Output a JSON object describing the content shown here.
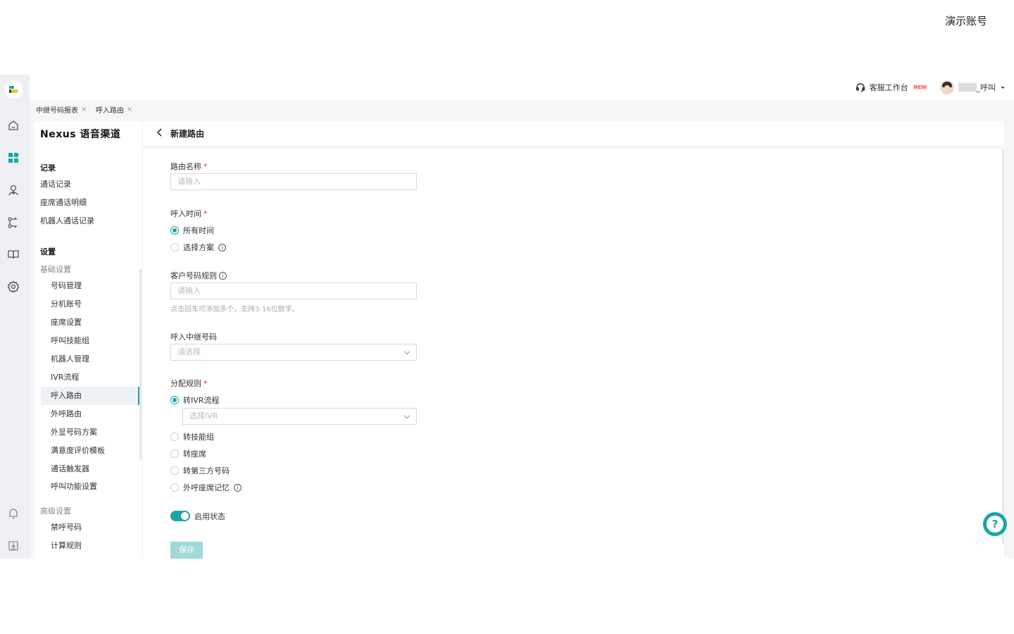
{
  "demo_label": "演示账号",
  "colors": {
    "accent": "#1aa6a6",
    "required": "#f5222d",
    "new_badge": "#ff4d4f"
  },
  "topbar": {
    "workbench_label": "客服工作台",
    "new_badge": "NEW",
    "user_suffix": "_呼叫"
  },
  "tabs": [
    {
      "label": "中继号码报表",
      "close": "×"
    },
    {
      "label": "呼入路由",
      "close": "×"
    }
  ],
  "rail_icons": [
    "home-icon",
    "dashboard-icon",
    "agent-icon",
    "route-icon",
    "book-icon",
    "settings-icon",
    "bell-icon",
    "download-icon"
  ],
  "sidebar": {
    "title": "Nexus 语音渠道",
    "records_group": "记录",
    "records": [
      "通话记录",
      "座席通话明细",
      "机器人通话记录"
    ],
    "settings_group": "设置",
    "basic_sub": "基础设置",
    "basic": [
      "号码管理",
      "分机账号",
      "座席设置",
      "呼叫技能组",
      "机器人管理",
      "IVR流程",
      "呼入路由",
      "外呼路由",
      "外显号码方案",
      "满意度评价模板",
      "通话触发器",
      "呼叫功能设置"
    ],
    "active_item": "呼入路由",
    "advanced_sub": "高级设置",
    "advanced": [
      "禁呼号码",
      "计算规则"
    ]
  },
  "form": {
    "page_title": "新建路由",
    "route_name": {
      "label": "路由名称",
      "placeholder": "请输入"
    },
    "call_time": {
      "label": "呼入时间",
      "options": [
        "所有时间",
        "选择方案"
      ],
      "selected": "所有时间"
    },
    "customer_rule": {
      "label": "客户号码规则",
      "placeholder": "请输入",
      "hint": "点击回车可添加多个，支持3-16位数字。"
    },
    "trunk": {
      "label": "呼入中继号码",
      "placeholder": "请选择"
    },
    "dispatch": {
      "label": "分配规则",
      "options": [
        "转IVR流程",
        "转技能组",
        "转座席",
        "转第三方号码",
        "外呼座席记忆"
      ],
      "selected": "转IVR流程",
      "ivr_placeholder": "选择IVR"
    },
    "status": {
      "label": "启用状态",
      "enabled": true
    },
    "save_label": "保存",
    "required_mark": "*"
  },
  "help_glyph": "?"
}
